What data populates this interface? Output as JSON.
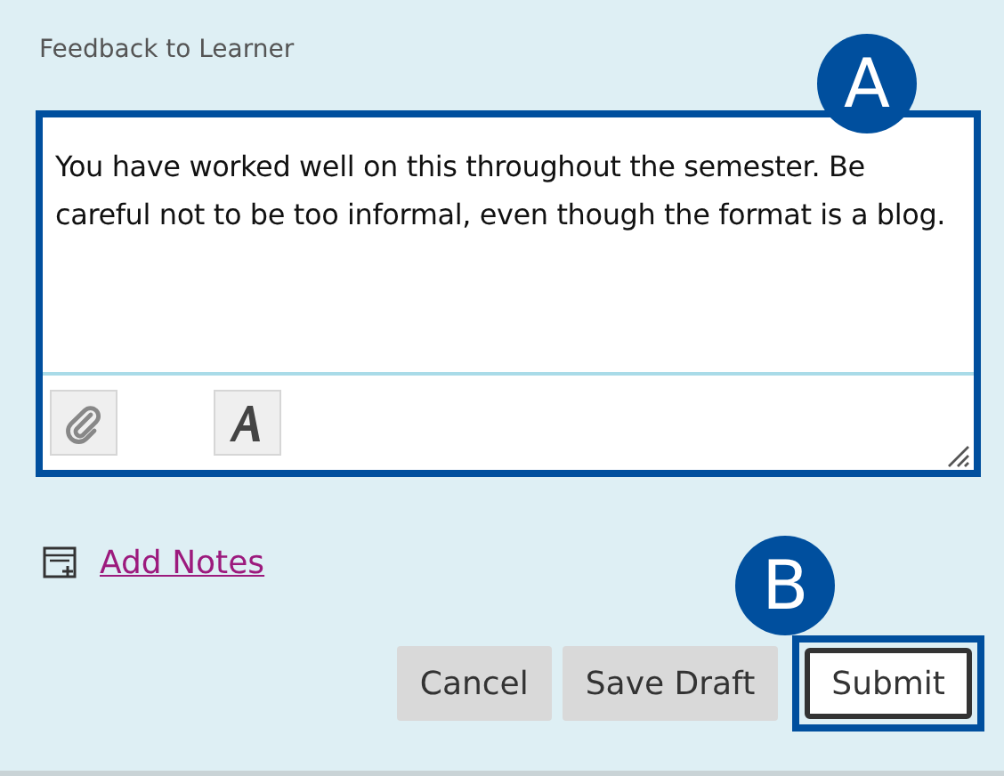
{
  "feedback": {
    "label": "Feedback to Learner",
    "value": "You have worked well on this throughout the semester. Be careful not to be too informal, even though the format is a blog.",
    "highlighted": true,
    "callout": "A"
  },
  "add_notes": {
    "label": "Add Notes"
  },
  "buttons": [
    {
      "label": "Cancel",
      "kind": "secondary"
    },
    {
      "label": "Save Draft",
      "kind": "secondary"
    },
    {
      "label": "Submit",
      "kind": "primary",
      "callout": "B"
    }
  ]
}
